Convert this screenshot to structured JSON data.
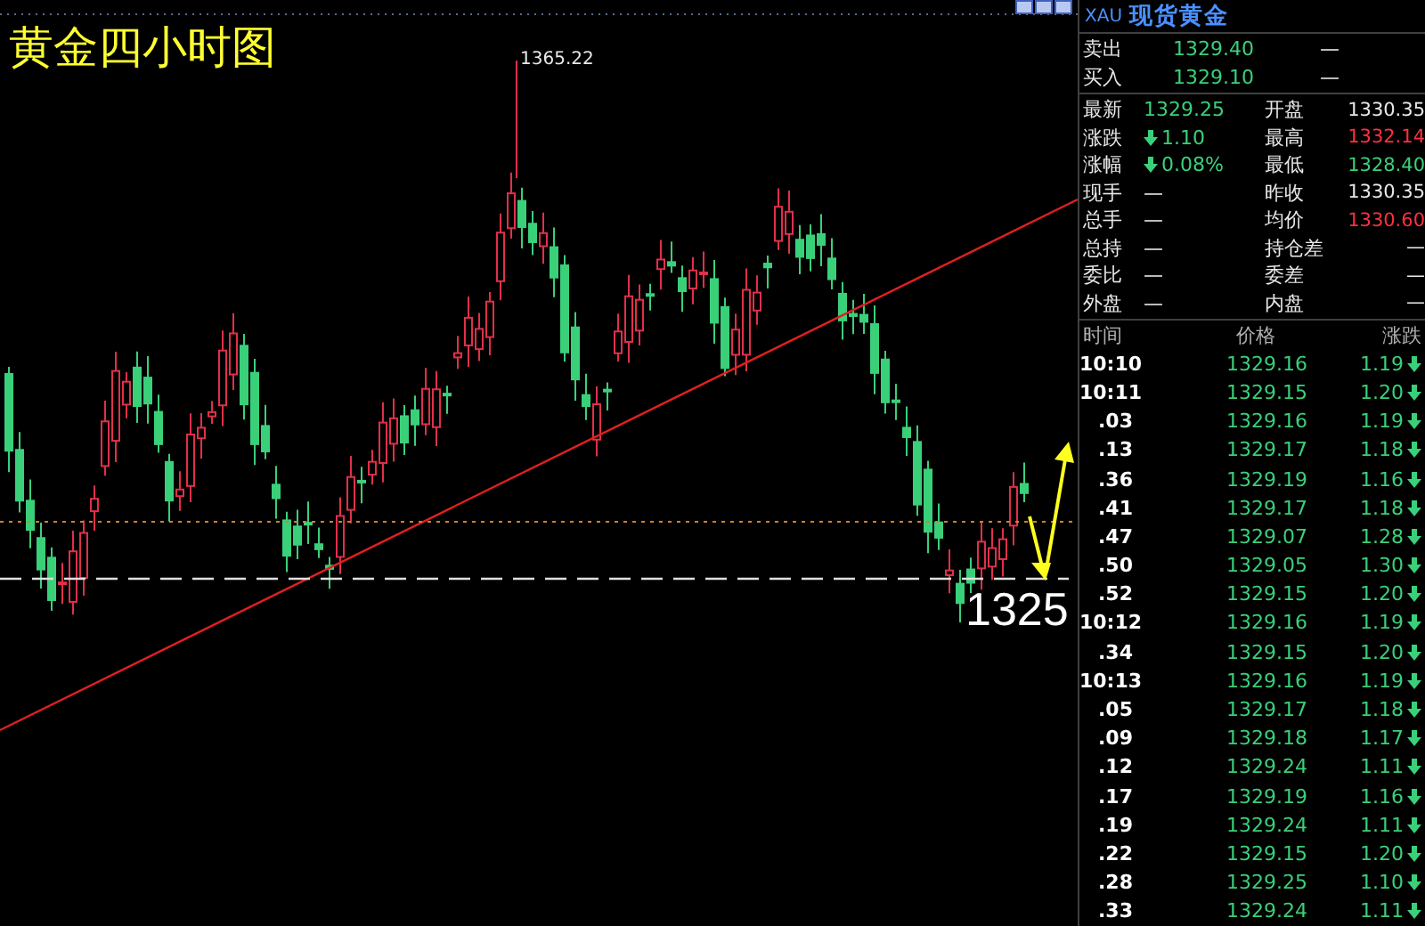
{
  "chart": {
    "title": "黄金四小时图",
    "peak_label": "1365.22",
    "level_label": "1325"
  },
  "panel": {
    "symbol": "XAU",
    "name": "现货黄金",
    "book": [
      {
        "label": "卖出",
        "value": "1329.40",
        "color": "#3ad07a",
        "extra": "—"
      },
      {
        "label": "买入",
        "value": "1329.10",
        "color": "#3ad07a",
        "extra": "—"
      }
    ],
    "quotes": [
      {
        "label": "最新",
        "value": "1329.25",
        "color": "#3ad07a",
        "falling": false
      },
      {
        "label": "开盘",
        "value": "1330.35",
        "color": "#e8e8e8",
        "falling": false
      },
      {
        "label": "涨跌",
        "value": "1.10",
        "color": "#3ad07a",
        "falling": true
      },
      {
        "label": "最高",
        "value": "1332.14",
        "color": "#ff3040",
        "falling": false
      },
      {
        "label": "涨幅",
        "value": "0.08%",
        "color": "#3ad07a",
        "falling": true
      },
      {
        "label": "最低",
        "value": "1328.40",
        "color": "#3ad07a",
        "falling": false
      },
      {
        "label": "现手",
        "value": "—",
        "falling": false
      },
      {
        "label": "昨收",
        "value": "1330.35",
        "color": "#e8e8e8",
        "falling": false
      },
      {
        "label": "总手",
        "value": "—",
        "falling": false
      },
      {
        "label": "均价",
        "value": "1330.60",
        "color": "#ff3040",
        "falling": false
      },
      {
        "label": "总持",
        "value": "—",
        "falling": false
      },
      {
        "label": "持仓差",
        "value": "—",
        "falling": false
      },
      {
        "label": "委比",
        "value": "—",
        "falling": false
      },
      {
        "label": "委差",
        "value": "—",
        "falling": false
      },
      {
        "label": "外盘",
        "value": "—",
        "falling": false
      },
      {
        "label": "内盘",
        "value": "—",
        "falling": false
      }
    ],
    "trade_columns": [
      "时间",
      "价格",
      "涨跌"
    ],
    "trades": [
      {
        "time": "10:10",
        "price": "1329.16",
        "change": "1.19",
        "falling": true
      },
      {
        "time": "10:11",
        "price": "1329.15",
        "change": "1.20",
        "falling": true
      },
      {
        "time": ".03",
        "price": "1329.16",
        "change": "1.19",
        "falling": true
      },
      {
        "time": ".13",
        "price": "1329.17",
        "change": "1.18",
        "falling": true
      },
      {
        "time": ".36",
        "price": "1329.19",
        "change": "1.16",
        "falling": true
      },
      {
        "time": ".41",
        "price": "1329.17",
        "change": "1.18",
        "falling": true
      },
      {
        "time": ".47",
        "price": "1329.07",
        "change": "1.28",
        "falling": true
      },
      {
        "time": ".50",
        "price": "1329.05",
        "change": "1.30",
        "falling": true
      },
      {
        "time": ".52",
        "price": "1329.15",
        "change": "1.20",
        "falling": true
      },
      {
        "time": "10:12",
        "price": "1329.16",
        "change": "1.19",
        "falling": true
      },
      {
        "time": ".34",
        "price": "1329.15",
        "change": "1.20",
        "falling": true
      },
      {
        "time": "10:13",
        "price": "1329.16",
        "change": "1.19",
        "falling": true
      },
      {
        "time": ".05",
        "price": "1329.17",
        "change": "1.18",
        "falling": true
      },
      {
        "time": ".09",
        "price": "1329.18",
        "change": "1.17",
        "falling": true
      },
      {
        "time": ".12",
        "price": "1329.24",
        "change": "1.11",
        "falling": true
      },
      {
        "time": ".17",
        "price": "1329.19",
        "change": "1.16",
        "falling": true
      },
      {
        "time": ".19",
        "price": "1329.24",
        "change": "1.11",
        "falling": true
      },
      {
        "time": ".22",
        "price": "1329.15",
        "change": "1.20",
        "falling": true
      },
      {
        "time": ".28",
        "price": "1329.25",
        "change": "1.10",
        "falling": true
      },
      {
        "time": ".33",
        "price": "1329.24",
        "change": "1.11",
        "falling": true
      }
    ]
  }
}
